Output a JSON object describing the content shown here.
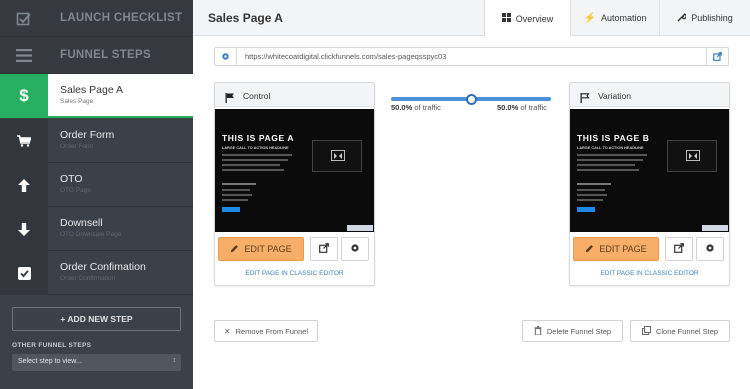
{
  "sidebar": {
    "launch_checklist": "LAUNCH CHECKLIST",
    "funnel_steps": "FUNNEL STEPS",
    "steps": [
      {
        "name": "Sales Page A",
        "sub": "Sales Page",
        "icon": "dollar-icon"
      },
      {
        "name": "Order Form",
        "sub": "Order Form",
        "icon": "cart-icon"
      },
      {
        "name": "OTO",
        "sub": "OTO Page",
        "icon": "arrow-up-icon"
      },
      {
        "name": "Downsell",
        "sub": "OTO Downsale Page",
        "icon": "arrow-down-icon"
      },
      {
        "name": "Order Confimation",
        "sub": "Order Confirmation",
        "icon": "checkbox-icon"
      }
    ],
    "add_new_step": "+ ADD NEW STEP",
    "other_funnel_steps": "OTHER FUNNEL STEPS",
    "select_placeholder": "Select step to view..."
  },
  "header": {
    "title": "Sales Page A",
    "tabs": [
      {
        "label": "Overview",
        "active": true
      },
      {
        "label": "Automation",
        "active": false
      },
      {
        "label": "Publishing",
        "active": false
      }
    ]
  },
  "url": "https://whitecoatdigital.clickfunnels.com/sales-pageqsspyc03",
  "split_test": {
    "control_traffic": "50.0%",
    "variation_traffic": "50.0%",
    "traffic_suffix": "of traffic",
    "slider_fraction": 0.5
  },
  "control": {
    "title": "Control",
    "preview_heading": "THIS IS PAGE A",
    "preview_sub": "LARGE CALL TO ACTION HEADLINE",
    "edit_label": "EDIT PAGE",
    "classic_link": "EDIT PAGE IN CLASSIC EDITOR"
  },
  "variation": {
    "title": "Variation",
    "preview_heading": "THIS IS PAGE B",
    "preview_sub": "LARGE CALL TO ACTION HEADLINE",
    "edit_label": "EDIT PAGE",
    "classic_link": "EDIT PAGE IN CLASSIC EDITOR"
  },
  "footer": {
    "remove": "Remove From Funnel",
    "delete": "Delete Funnel Step",
    "clone": "Clone Funnel Step"
  },
  "colors": {
    "sidebar": "#3b4148",
    "active_green": "#27ae60",
    "edit_orange": "#f6ae68",
    "link_blue": "#3a7fc1"
  }
}
